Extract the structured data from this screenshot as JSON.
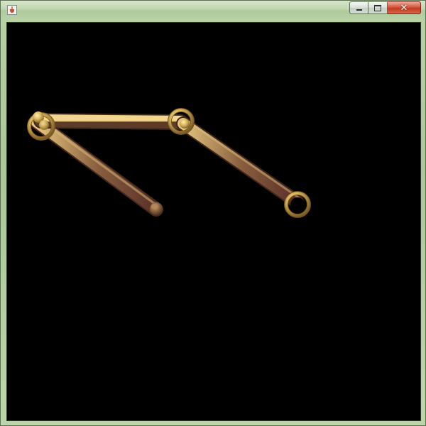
{
  "window": {
    "title": "",
    "controls": {
      "minimize": "minimize-icon",
      "maximize": "maximize-icon",
      "close": "close-icon",
      "close_glyph": "✕"
    }
  },
  "canvas": {
    "background": "#000000"
  },
  "colors": {
    "frame": "#b3ce9f",
    "close_button": "#c8472b",
    "link_light": "#e8c97a",
    "link_dark": "#6a3f2a",
    "joint": "#d9b45a"
  }
}
